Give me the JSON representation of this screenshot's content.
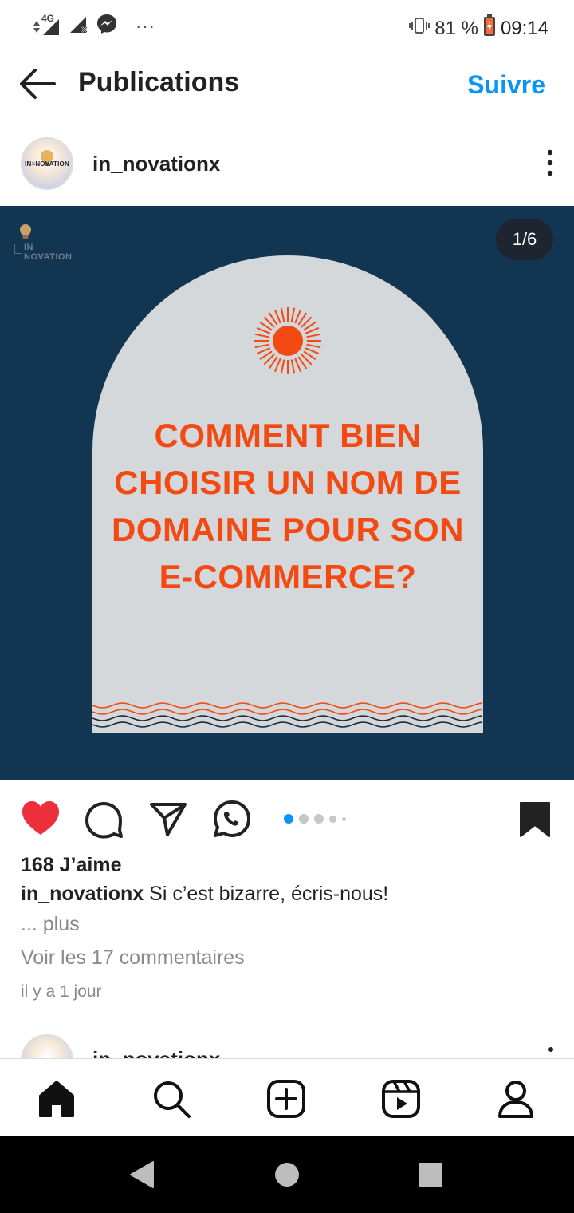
{
  "status_bar": {
    "network": "4G",
    "more": "···",
    "battery": "81 %",
    "time": "09:14",
    "icons": [
      "signal-4g-icon",
      "signal-x-icon",
      "messenger-icon",
      "vibrate-icon",
      "battery-icon"
    ]
  },
  "header": {
    "title": "Publications",
    "follow_label": "Suivre"
  },
  "post": {
    "username": "in_novationx",
    "avatar_logo_text": "IN≡NOVATION",
    "image": {
      "watermark_text": "IN NOVATION",
      "counter": "1/6",
      "headline_lines": [
        "COMMENT BIEN",
        "CHOISIR UN NOM DE",
        "DOMAINE POUR SON",
        "E-COMMERCE?"
      ],
      "colors": {
        "background": "#123652",
        "arch": "#d4d8da",
        "accent": "#f24a12",
        "wave_dark": "#1a2a3a"
      }
    },
    "carousel": {
      "count": 5,
      "active_index": 0
    },
    "likes": "168 J’aime",
    "caption_text": "Si c’est bizarre, écris-nous!",
    "more_label": "... plus",
    "comments_label": "Voir les 17 commentaires",
    "time_ago": "il y a 1 jour",
    "liked": true
  },
  "next_post": {
    "username": "in_novationx"
  },
  "bottom_nav": {
    "items": [
      "home-icon",
      "search-icon",
      "create-icon",
      "reels-icon",
      "profile-icon"
    ],
    "active": "home-icon"
  },
  "colors": {
    "link_blue": "#0a95f6",
    "like_red": "#ed2f3d"
  }
}
